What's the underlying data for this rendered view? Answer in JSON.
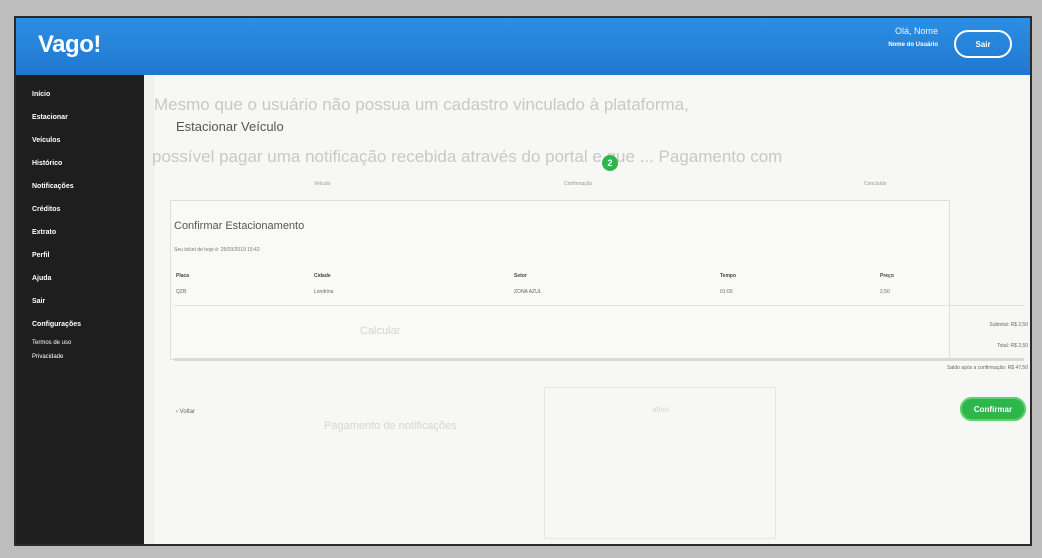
{
  "header": {
    "brand": "Vago!",
    "greeting": "Olá, Nome",
    "user_name": "Nome do Usuário",
    "exit_label": "Sair"
  },
  "sidebar": {
    "items": [
      {
        "label": "Início"
      },
      {
        "label": "Estacionar"
      },
      {
        "label": "Veículos"
      },
      {
        "label": "Histórico"
      },
      {
        "label": "Notificações"
      },
      {
        "label": "Créditos"
      },
      {
        "label": "Extrato"
      },
      {
        "label": "Perfil"
      },
      {
        "label": "Ajuda"
      },
      {
        "label": "Sair"
      },
      {
        "label": "Configurações"
      }
    ],
    "footer_1": "Termos de uso",
    "footer_2": "Privacidade"
  },
  "background_text": {
    "line1": "Mesmo que o usuário não possua um cadastro vinculado à plataforma,",
    "line2": "possível pagar uma notificação recebida através do portal e que ... Pagamento com",
    "mid1": "Pagamento de notificações",
    "mid2": "ativo"
  },
  "page": {
    "title": "Estacionar Veículo",
    "steps": [
      "Veículo",
      "Confirmação",
      "Concluído"
    ],
    "active_step": "2"
  },
  "confirm": {
    "title": "Confirmar Estacionamento",
    "subtitle": "Seu ticket de hoje é: 25/03/2019 15:42",
    "columns": [
      "Placa",
      "Cidade",
      "Setor",
      "Tempo",
      "Preço"
    ],
    "row": [
      "QZB",
      "Londrina",
      "ZONA AZUL",
      "01:00",
      "2,50"
    ]
  },
  "totals": {
    "subtotal": "Subtotal: R$ 2,50",
    "total": "Total: R$ 2,50",
    "balance": "Saldo após a confirmação: R$ 47,50",
    "ghost_label": "Calcular"
  },
  "actions": {
    "back": "‹ Voltar",
    "confirm": "Confirmar"
  },
  "colors": {
    "topbar": "#2c8fe3",
    "sidebar": "#1e1e1e",
    "accent_green": "#2db64a"
  }
}
